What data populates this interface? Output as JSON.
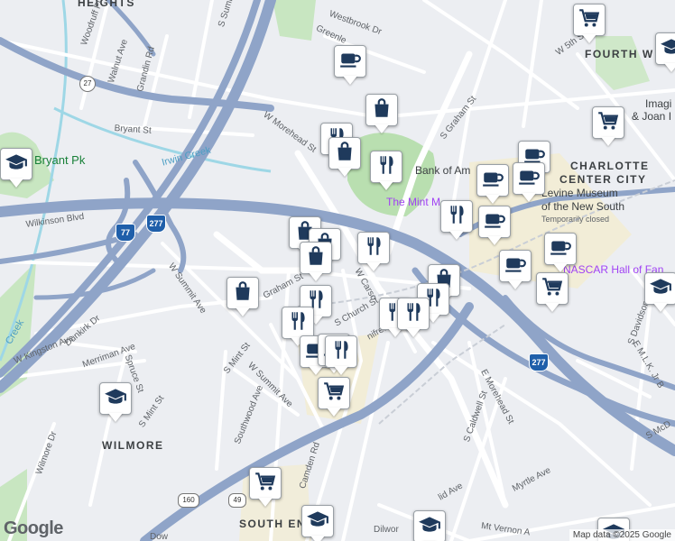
{
  "areas": {
    "heights": "HEIGHTS",
    "fourth_ward": "FOURTH W",
    "charlotte_center_city_1": "CHARLOTTE",
    "charlotte_center_city_2": "CENTER CITY",
    "wilmore": "WILMORE",
    "south_end": "SOUTH EN"
  },
  "streets": {
    "woodruff_pl": "Woodruff Pl",
    "walnut_ave": "Walnut Ave",
    "grandin_rd": "Grandin Rd",
    "w_summit_top": "S Summit",
    "westbrook_dr": "Westbrook Dr",
    "greenleaf": "Greenle",
    "w_5th_st": "W 5th St",
    "w_morehead_st": "W Morehead St",
    "bryant_st": "Bryant St",
    "s_graham_st": "S Graham St",
    "wilkinson_blvd": "Wilkinson Blvd",
    "w_summit_ave": "W Summit Ave",
    "w_graham_st": "Graham St",
    "w_carson": "W Carso",
    "s_church_st": "S Church St",
    "winifred_st": "nifred S",
    "dunkirk_dr": "Dunkirk Dr",
    "w_kingston_ave": "W Kingston Ave",
    "merriman_ave": "Merriman Ave",
    "spruce_st": "Spruce St",
    "s_mint_st": "S Mint St",
    "s_mint_st_2": "S Mint St",
    "w_summit_ave_2": "W Summit Ave",
    "southwood_ave": "Southwood Ave",
    "wilmore_dr": "Wilmore Dr",
    "camden_rd": "Camden Rd",
    "e_morehead_st": "E Morehead St",
    "s_caldwell_st": "S Caldwell St",
    "s_davidson_st": "S Davidson St",
    "e_mlk_jr": "E M.L.K. Jr B",
    "myrtle_ave": "Myrtle Ave",
    "euclid_ave": "lid Ave",
    "mt_vernon": "Mt Vernon A",
    "s_mcdowell": "S McD",
    "dilworth": "Dilwor",
    "dowd": "Dow"
  },
  "pois": {
    "bryant_pk": "Bryant Pk",
    "irwin_creek": "Irwin Creek",
    "bank_of_america": "Bank of Am",
    "mint_museum": "The Mint M",
    "levine_museum_1": "Levine Museum",
    "levine_museum_2": "of the New South",
    "levine_museum_3": "Temporarily closed",
    "nascar_hall": "NASCAR Hall of Fan",
    "imaginon_1": "Imagi",
    "imaginon_2": "& Joan I",
    "creek_left": "Creek"
  },
  "highways": {
    "i277_a": "277",
    "i277_b": "277",
    "i77": "77",
    "us29": "29",
    "nc160": "160",
    "us49": "49",
    "r27": "27"
  },
  "markers": [
    {
      "name": "coffee-marker",
      "icon": "coffee-icon"
    },
    {
      "name": "shopping-bag-marker",
      "icon": "shopping-bag-icon"
    },
    {
      "name": "restaurant-marker",
      "icon": "fork-knife-icon"
    },
    {
      "name": "shopping-bag-marker",
      "icon": "shopping-bag-icon"
    },
    {
      "name": "restaurant-marker",
      "icon": "fork-knife-icon"
    },
    {
      "name": "grocery-cart-marker",
      "icon": "cart-icon"
    },
    {
      "name": "school-marker",
      "icon": "graduation-cap-icon"
    },
    {
      "name": "grocery-cart-marker",
      "icon": "cart-icon"
    },
    {
      "name": "school-marker",
      "icon": "graduation-cap-icon"
    },
    {
      "name": "coffee-marker",
      "icon": "coffee-icon"
    },
    {
      "name": "coffee-marker",
      "icon": "coffee-icon"
    },
    {
      "name": "coffee-marker",
      "icon": "coffee-icon"
    },
    {
      "name": "restaurant-marker",
      "icon": "fork-knife-icon"
    },
    {
      "name": "coffee-marker",
      "icon": "coffee-icon"
    },
    {
      "name": "shopping-bag-marker",
      "icon": "shopping-bag-icon"
    },
    {
      "name": "shopping-bag-marker",
      "icon": "shopping-bag-icon"
    },
    {
      "name": "restaurant-marker",
      "icon": "fork-knife-icon"
    },
    {
      "name": "coffee-marker",
      "icon": "coffee-icon"
    },
    {
      "name": "coffee-marker",
      "icon": "coffee-icon"
    },
    {
      "name": "grocery-cart-marker",
      "icon": "cart-icon"
    },
    {
      "name": "school-marker",
      "icon": "graduation-cap-icon"
    },
    {
      "name": "shopping-bag-marker",
      "icon": "shopping-bag-icon"
    },
    {
      "name": "restaurant-marker",
      "icon": "fork-knife-icon"
    },
    {
      "name": "restaurant-marker",
      "icon": "fork-knife-icon"
    },
    {
      "name": "shopping-bag-marker",
      "icon": "shopping-bag-icon"
    },
    {
      "name": "restaurant-marker",
      "icon": "fork-knife-icon"
    },
    {
      "name": "shopping-bag-marker",
      "icon": "shopping-bag-icon"
    },
    {
      "name": "restaurant-marker",
      "icon": "fork-knife-icon"
    },
    {
      "name": "restaurant-marker",
      "icon": "fork-knife-icon"
    },
    {
      "name": "coffee-marker",
      "icon": "coffee-icon"
    },
    {
      "name": "coffee-marker",
      "icon": "coffee-icon"
    },
    {
      "name": "grocery-cart-marker",
      "icon": "cart-icon"
    },
    {
      "name": "school-marker",
      "icon": "graduation-cap-icon"
    },
    {
      "name": "grocery-cart-marker",
      "icon": "cart-icon"
    },
    {
      "name": "school-marker",
      "icon": "graduation-cap-icon"
    },
    {
      "name": "school-marker",
      "icon": "graduation-cap-icon"
    },
    {
      "name": "school-marker",
      "icon": "graduation-cap-icon"
    },
    {
      "name": "restaurant-marker",
      "icon": "fork-knife-icon"
    }
  ],
  "footer": {
    "logo": "Google",
    "attribution": "Map data ©2025 Google"
  },
  "colors": {
    "highway": "#8fa4c8",
    "road": "#ffffff",
    "park": "#c8e6c1",
    "water": "#9ed7e6",
    "downtown": "#f6edc9",
    "marker_icon": "#1f3a5c"
  }
}
